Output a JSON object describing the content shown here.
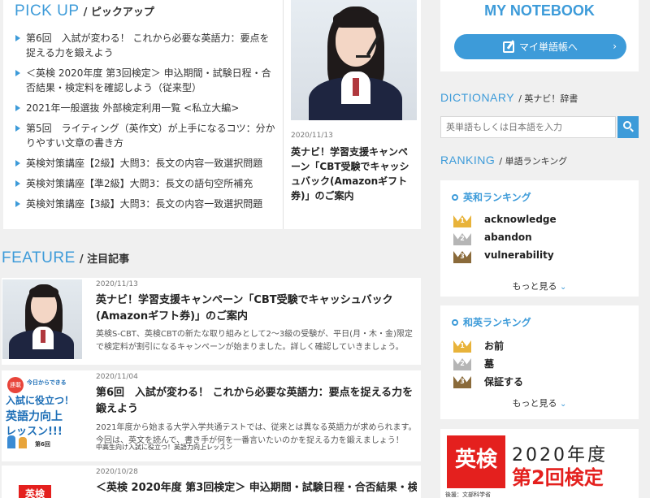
{
  "pickup": {
    "title_en": "PICK UP",
    "title_ja": "ピックアップ",
    "items": [
      {
        "text": "第6回　入試が変わる！ これから必要な英語力：要点を捉える力を鍛えよう"
      },
      {
        "text": "＜英検 2020年度 第3回検定＞ 申込期間・試験日程・合否結果・検定料を確認しよう（従来型）"
      },
      {
        "text": "2021年一般選抜 外部検定利用一覧 <私立大編>"
      },
      {
        "text": "第5回　ライティング（英作文）が上手になるコツ：分かりやすい文章の書き方"
      },
      {
        "text": "英検対策講座【2級】大問3：長文の内容一致選択問題"
      },
      {
        "text": "英検対策講座【準2級】大問3：長文の語句空所補充"
      },
      {
        "text": "英検対策講座【3級】大問3：長文の内容一致選択問題"
      }
    ],
    "feature": {
      "date": "2020/11/13",
      "title": "英ナビ！学習支援キャンペーン「CBT受験でキャッシュバック(Amazonギフト券)」のご案内"
    }
  },
  "feature": {
    "title_en": "FEATURE",
    "title_ja": "注目記事",
    "items": [
      {
        "date": "2020/11/13",
        "title": "英ナビ！学習支援キャンペーン「CBT受験でキャッシュバック(Amazonギフト券)」のご案内",
        "text": "英検S-CBT、英検CBTの新たな取り組みとして2〜3級の受験が、平日(月・木・金)限定で検定料が割引になるキャンペーンが始まりました。詳しく確認していきましょう。"
      },
      {
        "date": "2020/11/04",
        "title": "第6回　入試が変わる！ これから必要な英語力：要点を捉える力を鍛えよう",
        "text": "2021年度から始まる大学入学共通テストでは、従来とは異なる英語力が求められます。今回は、英文を読んで、書き手が何を一番言いたいのかを捉える力を鍛えましょう！",
        "subtext": "中高生向け入試に役立つ！英語力向上レッスン",
        "thumb": {
          "badge": "連載",
          "line1": "今日からできる",
          "line2": "入試に役立つ！",
          "line3": "英語力向上",
          "line4": "レッスン!!!",
          "line5": "第6回"
        }
      },
      {
        "date": "2020/10/28",
        "title": "＜英検 2020年度 第3回検定＞ 申込期間・試験日程・合否結果・検",
        "thumb_text": "英検"
      }
    ]
  },
  "notebook": {
    "title": "MY NOTEBOOK",
    "button": "マイ単語帳へ",
    "arrow": "›"
  },
  "dictionary": {
    "title_en": "DICTIONARY",
    "title_ja": "英ナビ！辞書",
    "placeholder": "英単語もしくは日本語を入力"
  },
  "ranking": {
    "title_en": "RANKING",
    "title_ja": "単語ランキング",
    "ej": {
      "title": "英和ランキング",
      "items": [
        {
          "rank": "1",
          "word": "acknowledge"
        },
        {
          "rank": "2",
          "word": "abandon"
        },
        {
          "rank": "3",
          "word": "vulnerability"
        }
      ],
      "more": "もっと見る"
    },
    "je": {
      "title": "和英ランキング",
      "items": [
        {
          "rank": "1",
          "word": "お前"
        },
        {
          "rank": "2",
          "word": "墓"
        },
        {
          "rank": "3",
          "word": "保証する"
        }
      ],
      "more": "もっと見る"
    }
  },
  "ad": {
    "logo": "英検",
    "year": "2020年度",
    "session": "第2回検定",
    "ministry": "後援：文部科学省"
  },
  "colors": {
    "accent": "#3d9bd9",
    "gold": "#e8b33a",
    "silver": "#b5b5b5",
    "bronze": "#8a6a3a",
    "eiken_red": "#e4201e"
  }
}
